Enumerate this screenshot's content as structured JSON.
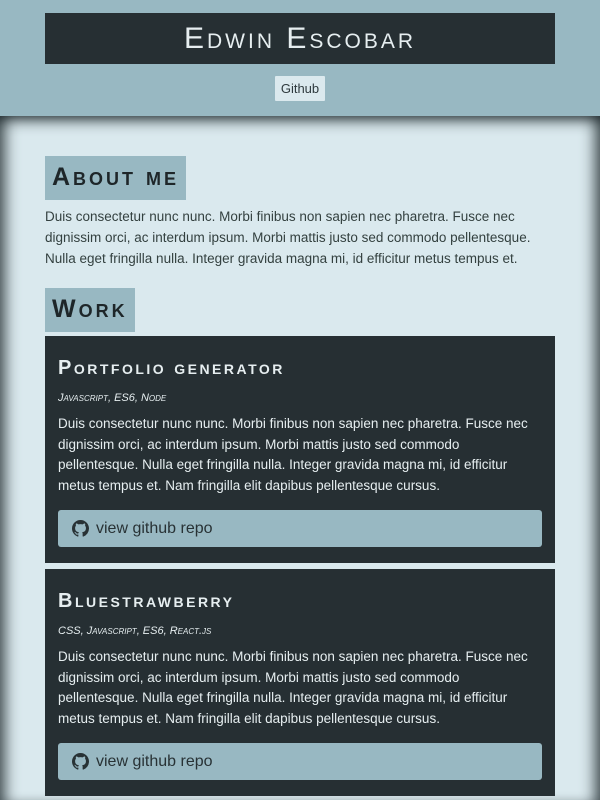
{
  "header": {
    "name": "Edwin Escobar",
    "nav": [
      {
        "label": "Github"
      }
    ]
  },
  "about": {
    "heading": "About me",
    "text": "Duis consectetur nunc nunc. Morbi finibus non sapien nec pharetra. Fusce nec dignissim orci, ac interdum ipsum. Morbi mattis justo sed commodo pellentesque. Nulla eget fringilla nulla. Integer gravida magna mi, id efficitur metus tempus et."
  },
  "work": {
    "heading": "Work",
    "projects": [
      {
        "title": "Portfolio generator",
        "tech": "Javascript, ES6, Node",
        "description": "Duis consectetur nunc nunc. Morbi finibus non sapien nec pharetra. Fusce nec dignissim orci, ac interdum ipsum. Morbi mattis justo sed commodo pellentesque. Nulla eget fringilla nulla. Integer gravida magna mi, id efficitur metus tempus et. Nam fringilla elit dapibus pellentesque cursus.",
        "button_label": "view github repo",
        "button_icon": "github-icon"
      },
      {
        "title": "Bluestrawberry",
        "tech": "CSS, Javascript, ES6, React.js",
        "description": "Duis consectetur nunc nunc. Morbi finibus non sapien nec pharetra. Fusce nec dignissim orci, ac interdum ipsum. Morbi mattis justo sed commodo pellentesque. Nulla eget fringilla nulla. Integer gravida magna mi, id efficitur metus tempus et. Nam fringilla elit dapibus pellentesque cursus.",
        "button_label": "view github repo",
        "button_icon": "github-icon"
      }
    ]
  },
  "colors": {
    "header_bg": "#98b8c2",
    "dark": "#262f33",
    "page_bg": "#dae9ee"
  }
}
